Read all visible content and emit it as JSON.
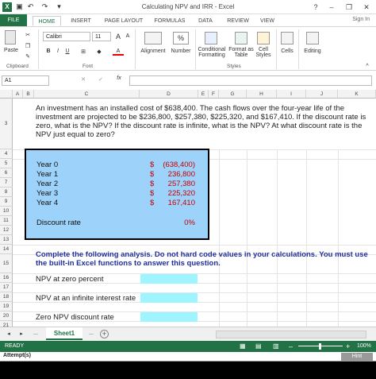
{
  "window": {
    "title": "Calculating NPV and IRR - Excel",
    "help": "?",
    "minimize": "–",
    "restore": "❐",
    "close": "✕"
  },
  "tabs": [
    "FILE",
    "HOME",
    "INSERT",
    "PAGE LAYOUT",
    "FORMULAS",
    "DATA",
    "REVIEW",
    "VIEW"
  ],
  "active_tab": "HOME",
  "signin": "Sign In",
  "ribbon": {
    "paste": "Paste",
    "clipboard": "Clipboard",
    "font_name": "Calibri",
    "font_size": "11",
    "font_group": "Font",
    "bold": "B",
    "italic": "I",
    "underline": "U",
    "alignment": "Alignment",
    "number": "Number",
    "conditional": "Conditional",
    "formatting": "Formatting",
    "format_as": "Format as",
    "table": "Table",
    "cell_styles_1": "Cell",
    "cell_styles_2": "Styles",
    "styles_group": "Styles",
    "cells": "Cells",
    "editing": "Editing",
    "percent": "%",
    "grow": "A",
    "shrink": "A"
  },
  "formula_bar": {
    "name_box": "A1",
    "fx": "fx",
    "cancel": "✕",
    "enter": "✓",
    "value": ""
  },
  "columns": [
    "A",
    "B",
    "C",
    "D",
    "E",
    "F",
    "G",
    "H",
    "I",
    "J",
    "K"
  ],
  "rows": [
    "3",
    "4",
    "5",
    "6",
    "7",
    "8",
    "9",
    "10",
    "11",
    "12",
    "13",
    "14",
    "15",
    "16",
    "17",
    "18",
    "19",
    "20",
    "21"
  ],
  "sheet": {
    "question": "An investment has an installed cost of $638,400. The cash flows over the four-year life of the investment are projected to be $236,800, $257,380, $225,320, and $167,410. If the discount rate is zero, what is the NPV? If the discount rate is infinite, what is the NPV? At what discount rate is the NPV just equal to zero?",
    "years": [
      {
        "label": "Year 0",
        "sign": "$",
        "value": "(638,400)"
      },
      {
        "label": "Year 1",
        "sign": "$",
        "value": "236,800"
      },
      {
        "label": "Year 2",
        "sign": "$",
        "value": "257,380"
      },
      {
        "label": "Year 3",
        "sign": "$",
        "value": "225,320"
      },
      {
        "label": "Year 4",
        "sign": "$",
        "value": "167,410"
      }
    ],
    "discount_label": "Discount rate",
    "discount_value": "0%",
    "instructions": "Complete the following analysis. Do not hard code values in your calculations. You must use the built-in Excel functions to answer this question.",
    "npv_zero": "NPV at zero percent",
    "npv_infinite": "NPV at an infinite interest rate",
    "zero_npv_rate": "Zero NPV discount rate"
  },
  "sheet_tabs": {
    "ellipsis_left": "...",
    "active": "Sheet1",
    "ellipsis_right": "...",
    "add": "+"
  },
  "status": {
    "ready": "READY",
    "zoom": "100%",
    "minus": "–",
    "plus": "+"
  },
  "attempt": "Attempt(s)",
  "hint": "Hint"
}
